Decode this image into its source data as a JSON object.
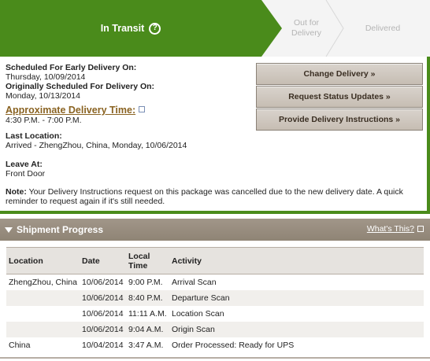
{
  "progress": {
    "active_step": "In Transit",
    "help_glyph": "?",
    "steps_next": [
      "Out for Delivery",
      "Delivered"
    ],
    "colors": {
      "active": "#4a8b1b",
      "inactive_text": "#b5b5b5"
    }
  },
  "details": {
    "early_label": "Scheduled For Early Delivery On:",
    "early_value": "Thursday, 10/09/2014",
    "orig_label": "Originally Scheduled For Delivery On:",
    "orig_value": "Monday, 10/13/2014",
    "approx_label": "Approximate Delivery Time:",
    "approx_value": "4:30 P.M. - 7:00 P.M.",
    "last_loc_label": "Last Location:",
    "last_loc_value": "Arrived - ZhengZhou, China, Monday, 10/06/2014",
    "leave_label": "Leave At:",
    "leave_value": "Front Door",
    "note_label": "Note:",
    "note_text": "Your Delivery Instructions request on this package was cancelled due to the new delivery date. A quick reminder to request again if it's still needed."
  },
  "actions": {
    "change": "Change Delivery »",
    "status": "Request Status Updates »",
    "instructions": "Provide Delivery Instructions »"
  },
  "shipment": {
    "title": "Shipment Progress",
    "whats_this": "What's This?",
    "columns": [
      "Location",
      "Date",
      "Local Time",
      "Activity"
    ],
    "rows": [
      [
        "ZhengZhou, China",
        "10/06/2014",
        "9:00 P.M.",
        "Arrival Scan"
      ],
      [
        "",
        "10/06/2014",
        "8:40 P.M.",
        "Departure Scan"
      ],
      [
        "",
        "10/06/2014",
        "11:11 A.M.",
        "Location Scan"
      ],
      [
        "",
        "10/06/2014",
        "9:04 A.M.",
        "Origin Scan"
      ],
      [
        "China",
        "10/04/2014",
        "3:47 A.M.",
        "Order Processed: Ready for UPS"
      ]
    ]
  }
}
